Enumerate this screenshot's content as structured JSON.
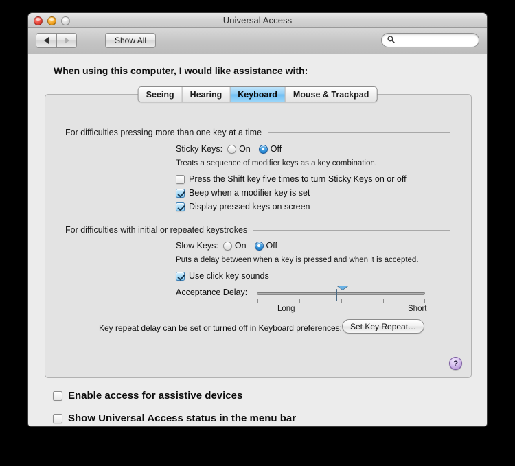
{
  "window": {
    "title": "Universal Access",
    "controls": {
      "close": "close-button",
      "minimize": "minimize-button",
      "zoom": "zoom-button"
    }
  },
  "toolbar": {
    "back_label": "◀",
    "forward_label": "▶",
    "show_all_label": "Show All",
    "search": {
      "value": "",
      "placeholder": ""
    }
  },
  "intro": {
    "text": "When using this computer, I would like assistance with:"
  },
  "tabs": [
    {
      "label": "Seeing",
      "active": false
    },
    {
      "label": "Hearing",
      "active": false
    },
    {
      "label": "Keyboard",
      "active": true
    },
    {
      "label": "Mouse & Trackpad",
      "active": false
    }
  ],
  "sticky_keys_group": {
    "heading": "For difficulties pressing more than one key at a time",
    "label": "Sticky Keys:",
    "options": [
      {
        "label": "On",
        "selected": false
      },
      {
        "label": "Off",
        "selected": true
      }
    ],
    "description": "Treats a sequence of modifier keys as a key combination.",
    "checkboxes": [
      {
        "label": "Press the Shift key five times to turn Sticky Keys on or off",
        "checked": false
      },
      {
        "label": "Beep when a modifier key is set",
        "checked": true
      },
      {
        "label": "Display pressed keys on screen",
        "checked": true
      }
    ]
  },
  "slow_keys_group": {
    "heading": "For difficulties with initial or repeated keystrokes",
    "label": "Slow Keys:",
    "options": [
      {
        "label": "On",
        "selected": false
      },
      {
        "label": "Off",
        "selected": true
      }
    ],
    "description": "Puts a delay between when a key is pressed and when it is accepted.",
    "checkbox": {
      "label": "Use click key sounds",
      "checked": true
    },
    "slider": {
      "label": "Acceptance Delay:",
      "min_label": "Long",
      "max_label": "Short",
      "ticks": 5,
      "value": 3
    }
  },
  "key_repeat": {
    "note": "Key repeat delay can be set or turned off in Keyboard preferences:",
    "button_label": "Set Key Repeat…"
  },
  "help": {
    "label": "?"
  },
  "bottom_options": [
    {
      "label": "Enable access for assistive devices",
      "checked": false
    },
    {
      "label": "Show Universal Access status in the menu bar",
      "checked": false
    }
  ]
}
